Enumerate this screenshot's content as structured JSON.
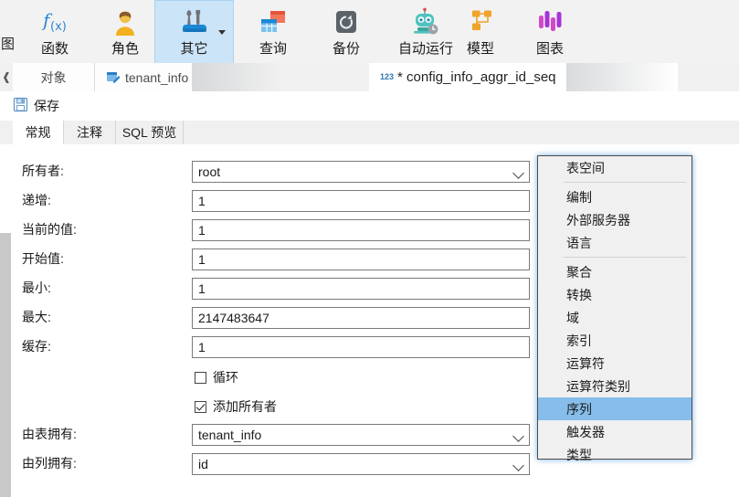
{
  "ribbon": {
    "clipped_label": "图",
    "buttons": [
      {
        "label": "函数",
        "icon": "function-fx-icon",
        "active": false,
        "caret": false
      },
      {
        "label": "角色",
        "icon": "user-role-icon",
        "active": false,
        "caret": false
      },
      {
        "label": "其它",
        "icon": "tools-other-icon",
        "active": true,
        "caret": true
      },
      {
        "label": "查询",
        "icon": "query-icon",
        "active": false,
        "caret": false
      },
      {
        "label": "备份",
        "icon": "backup-icon",
        "active": false,
        "caret": false
      },
      {
        "label": "自动运行",
        "icon": "automation-robot-icon",
        "active": false,
        "caret": false
      },
      {
        "label": "模型",
        "icon": "model-icon",
        "active": false,
        "caret": false
      },
      {
        "label": "图表",
        "icon": "chart-icon",
        "active": false,
        "caret": false
      }
    ]
  },
  "doc_tabs": [
    {
      "label": "对象",
      "icon": "",
      "selected": false
    },
    {
      "label": "tenant_info",
      "icon": "table-edit-icon",
      "selected": false
    },
    {
      "label": "* config_info_aggr_id_seq",
      "icon": "123",
      "selected": true
    }
  ],
  "toolbar": {
    "save_label": "保存",
    "save_icon": "floppy-save-icon"
  },
  "inner_tabs": [
    {
      "label": "常规",
      "selected": true
    },
    {
      "label": "注释",
      "selected": false
    },
    {
      "label": "SQL 预览",
      "selected": false
    }
  ],
  "form": {
    "fields": [
      {
        "label": "所有者:",
        "value": "root",
        "type": "select"
      },
      {
        "label": "递增:",
        "value": "1",
        "type": "text"
      },
      {
        "label": "当前的值:",
        "value": "1",
        "type": "text"
      },
      {
        "label": "开始值:",
        "value": "1",
        "type": "text"
      },
      {
        "label": "最小:",
        "value": "1",
        "type": "text"
      },
      {
        "label": "最大:",
        "value": "2147483647",
        "type": "text"
      },
      {
        "label": "缓存:",
        "value": "1",
        "type": "text"
      }
    ],
    "checkboxes": [
      {
        "label": "循环",
        "checked": false
      },
      {
        "label": "添加所有者",
        "checked": true
      }
    ],
    "owner_fields": [
      {
        "label": "由表拥有:",
        "value": "tenant_info",
        "type": "select"
      },
      {
        "label": "由列拥有:",
        "value": "id",
        "type": "select"
      }
    ]
  },
  "menu": {
    "items": [
      {
        "label": "表空间",
        "highlighted": false,
        "separator_after": true
      },
      {
        "label": "编制",
        "highlighted": false,
        "separator_after": false
      },
      {
        "label": "外部服务器",
        "highlighted": false,
        "separator_after": false
      },
      {
        "label": "语言",
        "highlighted": false,
        "separator_after": true
      },
      {
        "label": "聚合",
        "highlighted": false,
        "separator_after": false
      },
      {
        "label": "转换",
        "highlighted": false,
        "separator_after": false
      },
      {
        "label": "域",
        "highlighted": false,
        "separator_after": false
      },
      {
        "label": "索引",
        "highlighted": false,
        "separator_after": false
      },
      {
        "label": "运算符",
        "highlighted": false,
        "separator_after": false
      },
      {
        "label": "运算符类别",
        "highlighted": false,
        "separator_after": false
      },
      {
        "label": "序列",
        "highlighted": true,
        "separator_after": false
      },
      {
        "label": "触发器",
        "highlighted": false,
        "separator_after": false
      },
      {
        "label": "类型",
        "highlighted": false,
        "separator_after": false
      }
    ]
  },
  "colors": {
    "ribbon_bg": "#f2f2f2",
    "active_ribbon": "#cce4f7",
    "menu_highlight": "#86bdea",
    "menu_bg": "#f0f0f0",
    "accent": "#1e87d6"
  }
}
